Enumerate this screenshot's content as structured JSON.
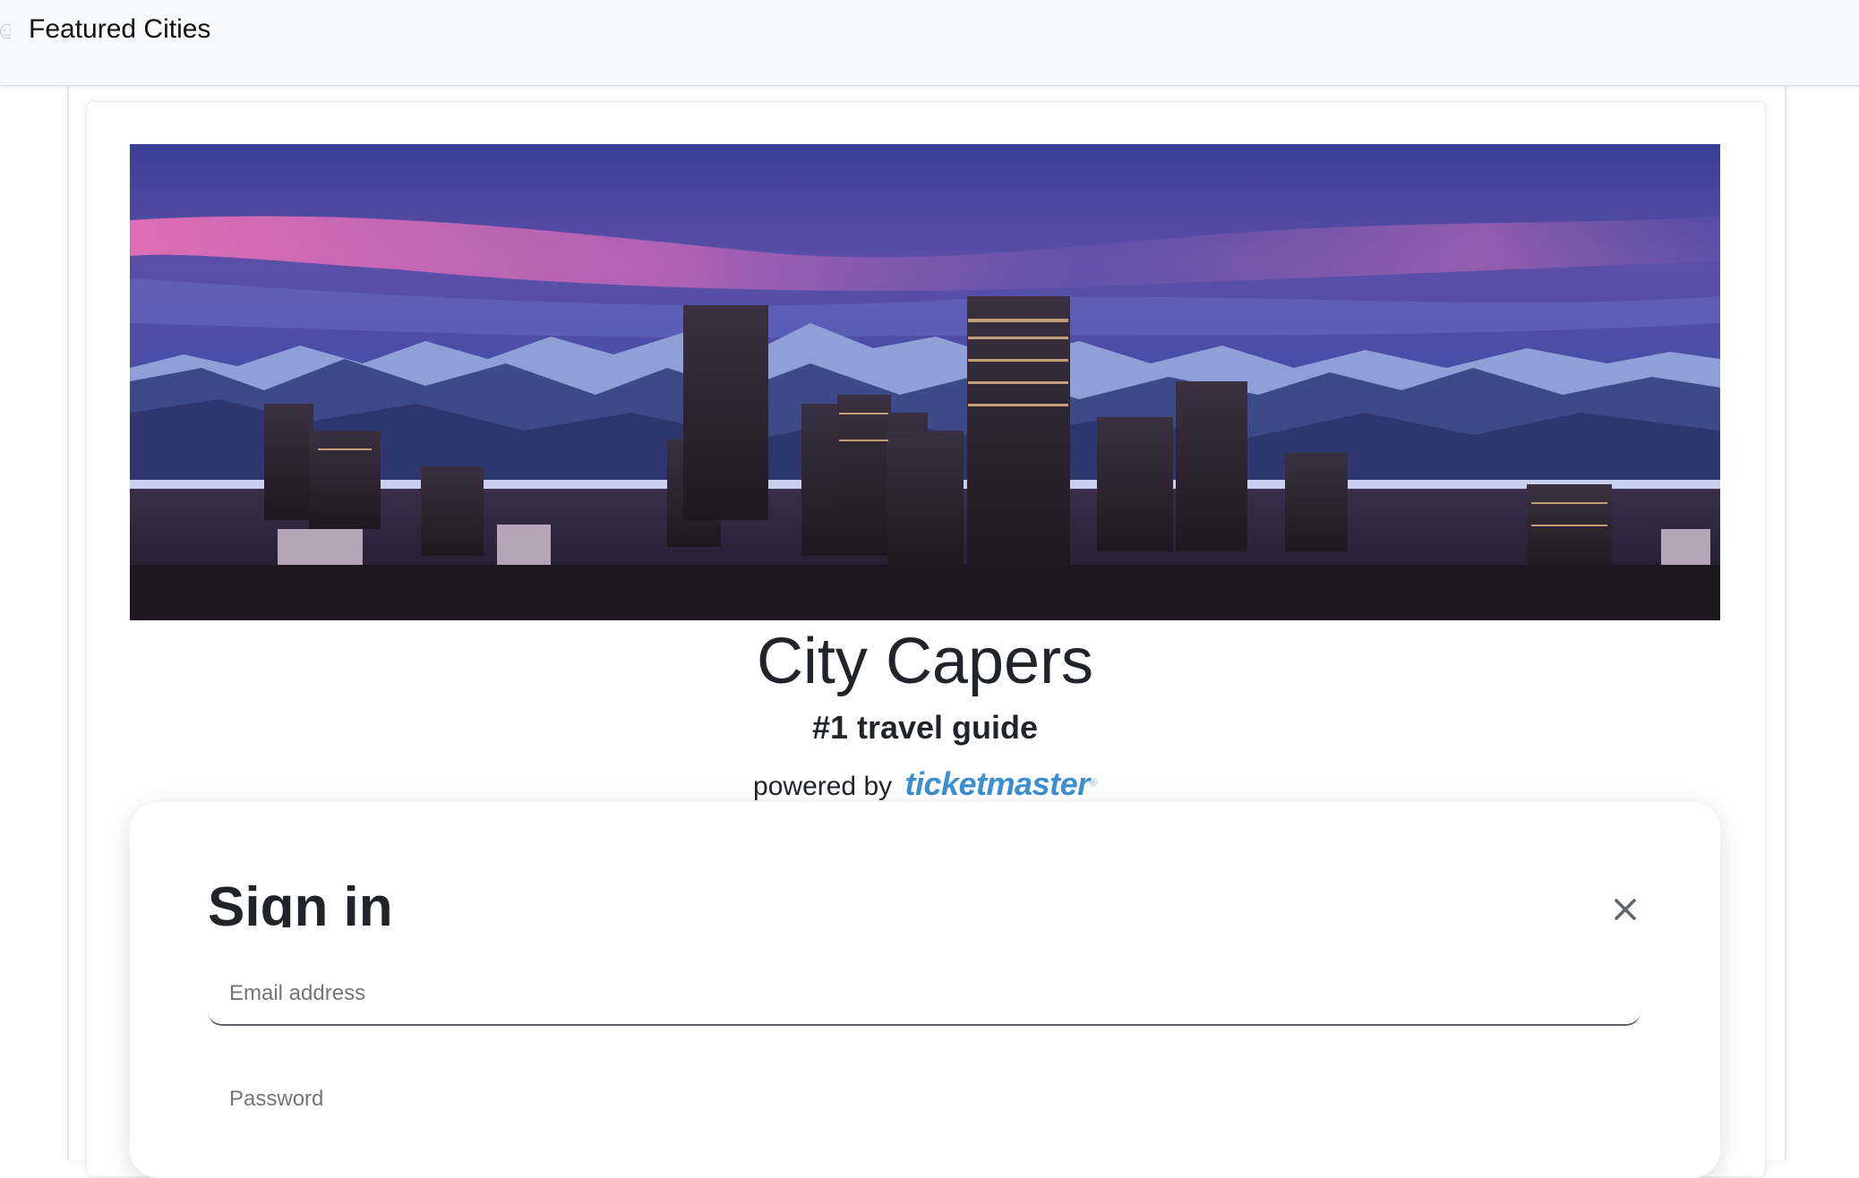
{
  "navbar": {
    "brand": "Featured Cities",
    "brand_icon": "person-icon"
  },
  "hero": {
    "image_alt": "Denver skyline at dusk with mountains"
  },
  "header": {
    "title": "City Capers",
    "subtitle": "#1 travel guide",
    "powered_by": "powered by",
    "partner_logo": "ticketmaster",
    "partner_logo_mark": "®"
  },
  "signin": {
    "title": "Sign in",
    "close_icon": "close-icon",
    "email_placeholder": "Email address",
    "password_placeholder": "Password"
  },
  "colors": {
    "navbar_bg": "#f8f9fa",
    "text": "#212529",
    "ticketmaster_blue": "#3c8fd0"
  }
}
